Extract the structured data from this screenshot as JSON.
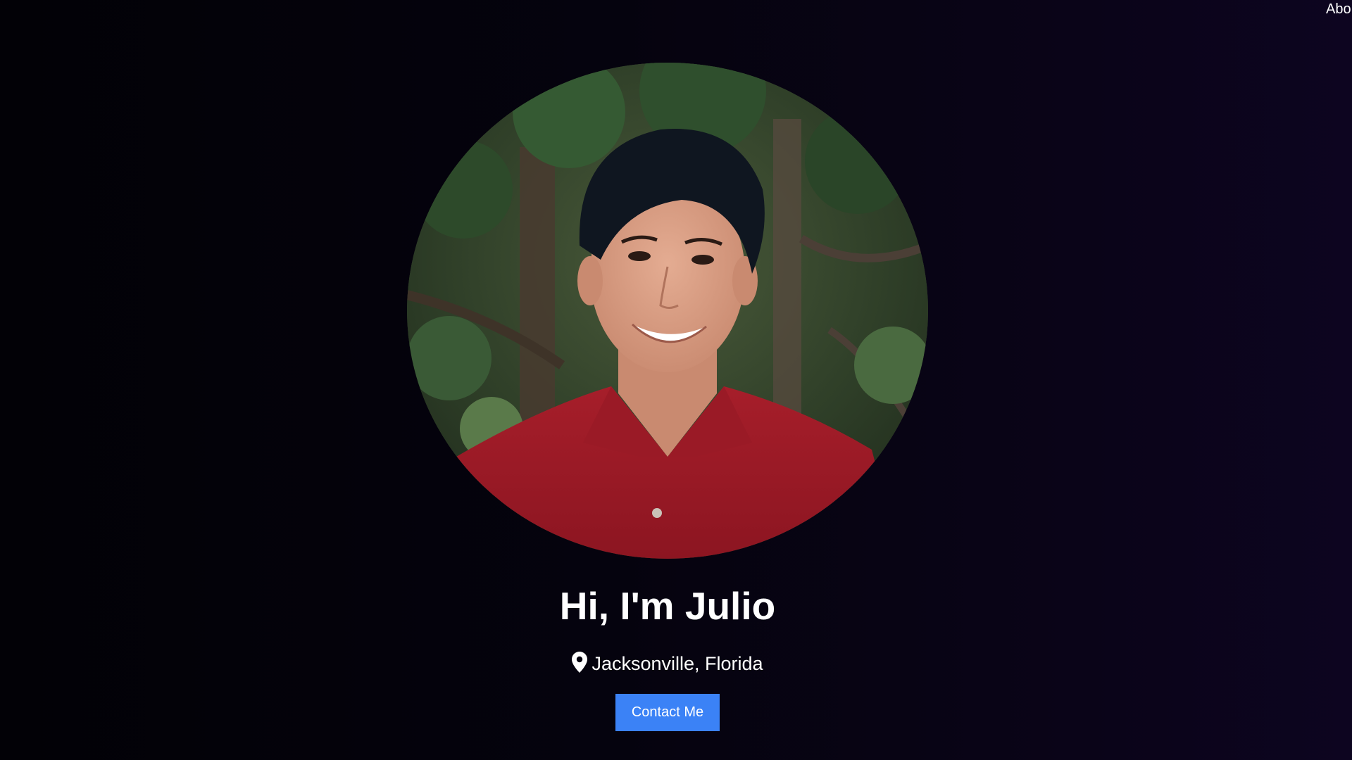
{
  "nav": {
    "about_label": "Abo"
  },
  "hero": {
    "title": "Hi, I'm Julio",
    "location": "Jacksonville, Florida",
    "location_icon": "map-pin-icon",
    "contact_label": "Contact Me"
  },
  "colors": {
    "background": "#05030e",
    "accent": "#3b82f6",
    "text": "#ffffff"
  }
}
